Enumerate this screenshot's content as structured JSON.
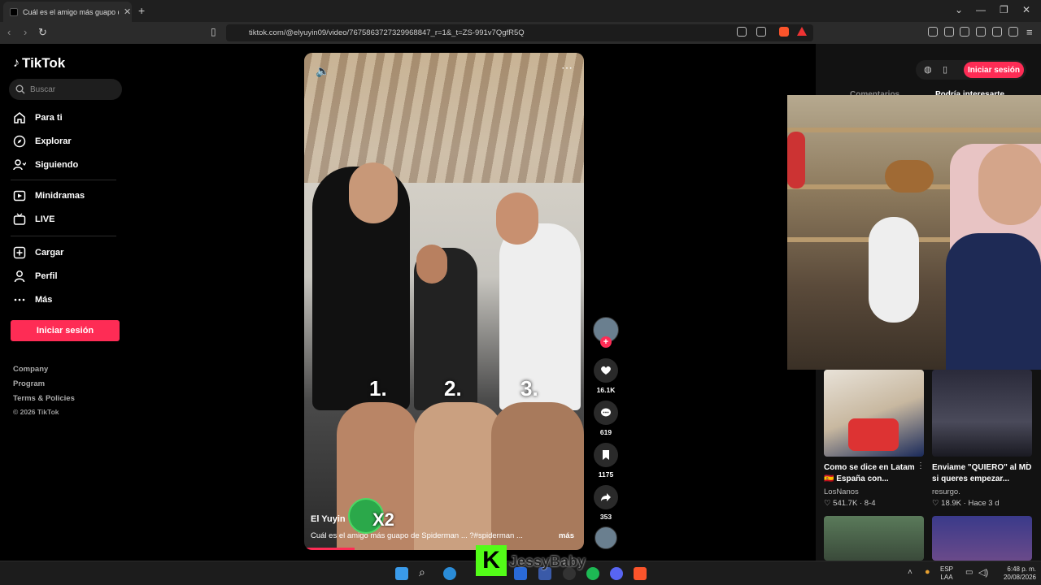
{
  "browser": {
    "tab_title": "Cuál es el amigo más guapo de",
    "new_tab": "+",
    "url": "tiktok.com/@elyuyin09/video/7675863727329968847_r=1&_t=ZS-991v7QgfR5Q"
  },
  "sidebar": {
    "logo": "TikTok",
    "search_placeholder": "Buscar",
    "items": [
      {
        "label": "Para ti",
        "icon": "home-icon"
      },
      {
        "label": "Explorar",
        "icon": "compass-icon"
      },
      {
        "label": "Siguiendo",
        "icon": "following-icon"
      },
      {
        "label": "Minidramas",
        "icon": "minidramas-icon"
      },
      {
        "label": "LIVE",
        "icon": "live-icon"
      },
      {
        "label": "Cargar",
        "icon": "upload-icon"
      },
      {
        "label": "Perfil",
        "icon": "profile-icon"
      },
      {
        "label": "Más",
        "icon": "more-icon"
      }
    ],
    "login_button": "Iniciar sesión",
    "footer": [
      "Company",
      "Program",
      "Terms & Policies",
      "© 2026 TikTok"
    ]
  },
  "video": {
    "labels": [
      "1.",
      "2.",
      "3."
    ],
    "author": "El Yuyin",
    "caption": "Cuál es el amigo más guapo de Spiderman ... ?#spiderman ...",
    "more": "más",
    "overlay": "X2",
    "progress": 0.18
  },
  "actions": {
    "likes": "16.1K",
    "comments": "619",
    "saves": "1175",
    "shares": "353"
  },
  "right_panel": {
    "login_button": "Iniciar sesión",
    "tabs": [
      "Comentarios",
      "Podría interesarte"
    ],
    "videos": [
      {
        "title": "Como se dice en Latam 🇪🇸 España con...",
        "channel": "LosNanos",
        "likes": "541.7K",
        "date": "8-4"
      },
      {
        "title": "Enviame \"QUIERO\" al MD si queres empezar...",
        "channel": "resurgo.",
        "likes": "18.9K",
        "date": "Hace 3 d"
      }
    ]
  },
  "stream_overlay": {
    "kick_letter": "K",
    "streamer": "JessyBaby"
  },
  "taskbar": {
    "lang": "ESP",
    "lang_sub": "LAA",
    "time": "6:48 p. m.",
    "date": "20/08/2026"
  },
  "colors": {
    "accent": "#fe2c55",
    "kick": "#53fc18"
  }
}
